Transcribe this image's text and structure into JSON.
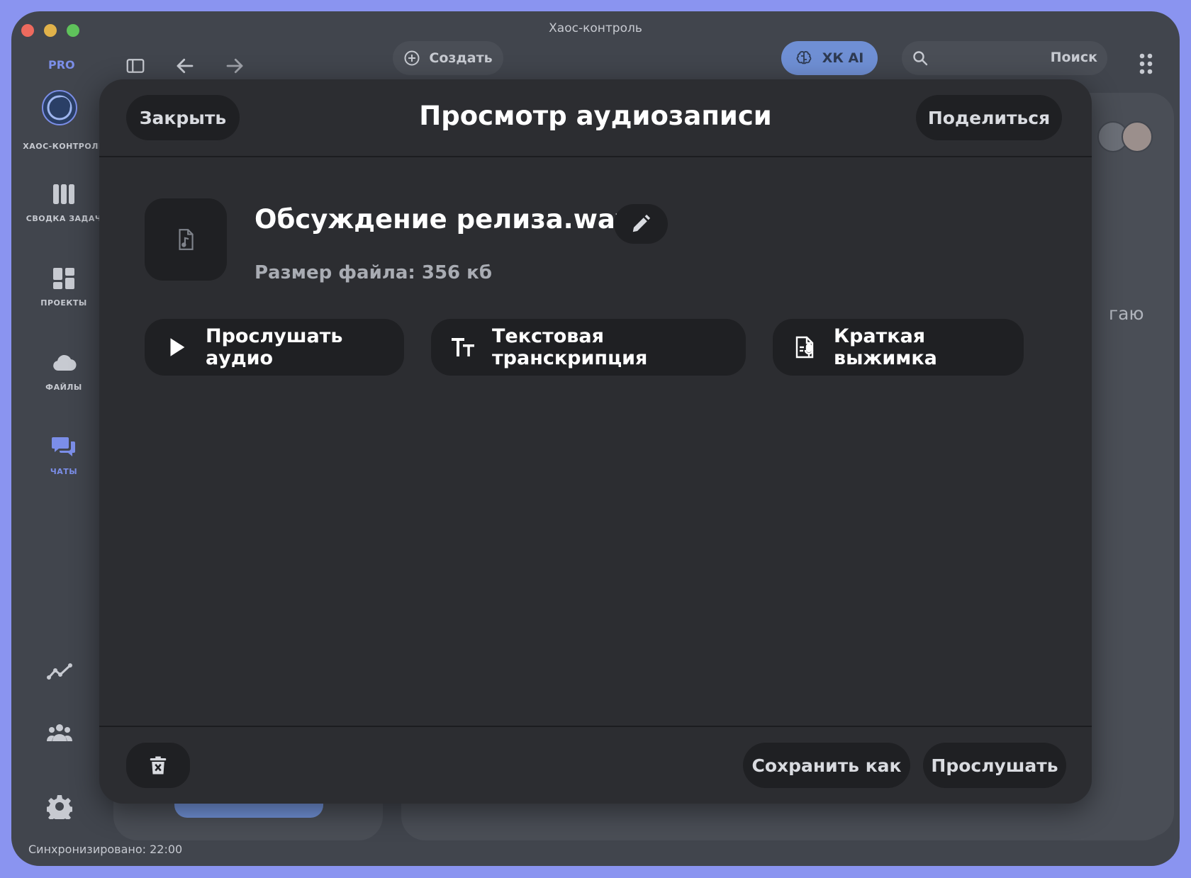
{
  "window": {
    "title": "Хаос-контроль"
  },
  "toolbar": {
    "pro_label": "PRO",
    "create_label": "Создать",
    "ai_label": "ХК AI",
    "search_placeholder": "Поиск"
  },
  "sidebar": {
    "logo_label": "ХАОС-КОНТРОЛЬ",
    "items": [
      {
        "label": "СВОДКА ЗАДАЧ",
        "icon": "columns-icon"
      },
      {
        "label": "ПРОЕКТЫ",
        "icon": "dashboard-icon"
      },
      {
        "label": "ФАЙЛЫ",
        "icon": "cloud-icon"
      },
      {
        "label": "ЧАТЫ",
        "icon": "chat-icon",
        "active": true
      }
    ],
    "bottom_icons": [
      "analytics-icon",
      "team-icon",
      "settings-icon"
    ]
  },
  "status": {
    "sync_text": "Синхронизировано: 22:00"
  },
  "background": {
    "partial_text": "гаю"
  },
  "modal": {
    "close_label": "Закрыть",
    "title": "Просмотр аудиозаписи",
    "share_label": "Поделиться",
    "file_name": "Обсуждение релиза.wav",
    "file_size": "Размер файла: 356 кб",
    "actions": [
      {
        "label": "Прослушать аудио",
        "icon": "play-icon"
      },
      {
        "label": "Текстовая транскрипция",
        "icon": "text-size-icon"
      },
      {
        "label": "Краткая выжимка",
        "icon": "summary-mic-icon"
      }
    ],
    "save_as_label": "Сохранить как",
    "listen_label": "Прослушать"
  },
  "colors": {
    "frame": "#8a94f0",
    "window_bg": "#41454d",
    "modal_bg": "#2c2d31",
    "button_bg": "#1f2023",
    "accent": "#7b8ee8",
    "ai_button": "#6f8fd4"
  }
}
